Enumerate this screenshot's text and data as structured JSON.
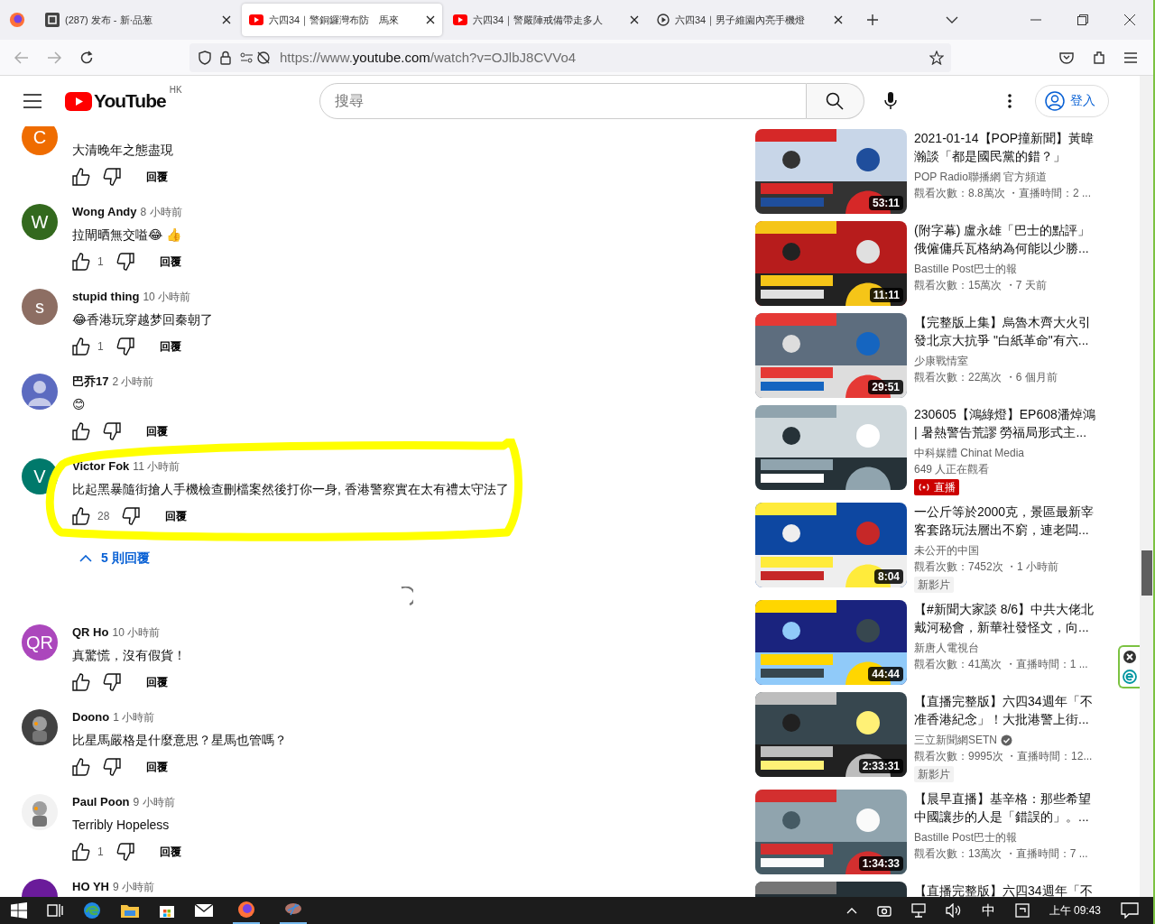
{
  "browser": {
    "tabs": [
      {
        "title": "(287) 发布 - 新·品葱",
        "kind": "site",
        "selected": false
      },
      {
        "title": "六四34｜警銅鑼灣布防　馬來",
        "kind": "youtube",
        "selected": true
      },
      {
        "title": "六四34｜警嚴陣戒備帶走多人",
        "kind": "youtube",
        "selected": false
      },
      {
        "title": "六四34｜男子維園內亮手機燈",
        "kind": "media",
        "selected": false
      }
    ],
    "url_prefix": "https://www.",
    "url_host": "youtube.com",
    "url_path": "/watch?v=OJlbJ8CVVo4"
  },
  "header": {
    "logo": "YouTube",
    "region": "HK",
    "search_placeholder": "搜尋",
    "sign_in": "登入"
  },
  "comments": [
    {
      "text": "大清晚年之態盡現",
      "avatar": {
        "kind": "letter",
        "letter": "C",
        "color": "#ef6c00"
      },
      "reply": "回覆",
      "highlighted": false
    },
    {
      "author": "Wong Andy",
      "time": "8 小時前",
      "text": "拉閘晒無交嗌😂 👍",
      "avatar": {
        "kind": "letter",
        "letter": "W",
        "color": "#33691e"
      },
      "likes": "1",
      "reply": "回覆",
      "highlighted": false
    },
    {
      "author": "stupid thing",
      "time": "10 小時前",
      "text": "😂香港玩穿越梦回秦朝了",
      "avatar": {
        "kind": "letter",
        "letter": "s",
        "color": "#8d6e63"
      },
      "likes": "1",
      "reply": "回覆",
      "highlighted": false
    },
    {
      "author": "巴乔17",
      "time": "2 小時前",
      "text": "😊",
      "avatar": {
        "kind": "default",
        "color": "#5c6bc0"
      },
      "reply": "回覆",
      "highlighted": false
    },
    {
      "author": "Victor Fok",
      "time": "11 小時前",
      "text": "比起黑暴隨街搶人手機檢查刪檔案然後打你一身, 香港警察實在太有禮太守法了",
      "avatar": {
        "kind": "letter",
        "letter": "V",
        "color": "#00796b"
      },
      "likes": "28",
      "reply": "回覆",
      "highlighted": true,
      "replies": {
        "label": "5 則回覆",
        "expanded": true,
        "loading": true
      }
    },
    {
      "author": "QR Ho",
      "time": "10 小時前",
      "text": "真驚慌，沒有假貨！",
      "avatar": {
        "kind": "letter",
        "letter": "QR",
        "color": "#ab47bc"
      },
      "reply": "回覆",
      "highlighted": false
    },
    {
      "author": "Doono",
      "time": "1 小時前",
      "text": "比星馬嚴格是什麼意思？星馬也管嗎？",
      "reply": "回覆",
      "highlighted": false
    },
    {
      "author": "Paul Poon",
      "time": "9 小時前",
      "text": "Terribly Hopeless",
      "likes": "1",
      "reply": "回覆",
      "highlighted": false
    },
    {
      "author": "HO YH",
      "time": "9 小時前",
      "avatar": {
        "kind": "blank",
        "color": "#6a1b9a"
      },
      "highlighted": false
    }
  ],
  "recommendations": [
    {
      "title": "2021-01-14【POP撞新聞】黃暐瀚談「都是國民黨的錯？」",
      "channel": "POP Radio聯播網 官方頻道",
      "verified": false,
      "meta": "觀看次數：8.8萬次 ・直播時間：2 ...",
      "duration": "53:11"
    },
    {
      "title": "(附字幕) 盧永雄「巴士的點評」俄僱傭兵瓦格納為何能以少勝...",
      "channel": "Bastille Post巴士的報",
      "verified": false,
      "meta": "觀看次數：15萬次 ・7 天前",
      "duration": "11:11"
    },
    {
      "title": "【完整版上集】烏魯木齊大火引發北京大抗爭 \"白紙革命\"有六...",
      "channel": "少康戰情室",
      "verified": false,
      "meta": "觀看次數：22萬次 ・6 個月前",
      "duration": "29:51"
    },
    {
      "title": "230605【鴻綠燈】EP608潘焯鴻 | 暑熱警告荒謬 勞福局形式主...",
      "channel": "中科媒體 Chinat Media",
      "verified": false,
      "meta": "649 人正在觀看",
      "badge": {
        "kind": "live",
        "label": "直播"
      }
    },
    {
      "title": "一公斤等於2000克，景區最新宰客套路玩法層出不窮，連老闆...",
      "channel": "未公开的中国",
      "verified": false,
      "meta": "觀看次數：7452次 ・1 小時前",
      "duration": "8:04",
      "badge": {
        "kind": "new",
        "label": "新影片"
      }
    },
    {
      "title": "【#新聞大家談 8/6】中共大佬北戴河秘會，新華社發怪文，向...",
      "channel": "新唐人電視台",
      "verified": false,
      "meta": "觀看次數：41萬次 ・直播時間：1 ...",
      "duration": "44:44"
    },
    {
      "title": "【直播完整版】六四34週年「不准香港紀念」！大批港警上街...",
      "channel": "三立新聞網SETN",
      "verified": true,
      "meta": "觀看次數：9995次 ・直播時間：12...",
      "duration": "2:33:31",
      "badge": {
        "kind": "new",
        "label": "新影片"
      }
    },
    {
      "title": "【晨早直播】基辛格：那些希望中國讓步的人是「錯誤的」。...",
      "channel": "Bastille Post巴士的報",
      "verified": false,
      "meta": "觀看次數：13萬次 ・直播時間：7 ...",
      "duration": "1:34:33"
    },
    {
      "title": "【直播完整版】六四34週年「不"
    }
  ],
  "taskbar": {
    "ime": "中",
    "time": "上午 09:43"
  }
}
